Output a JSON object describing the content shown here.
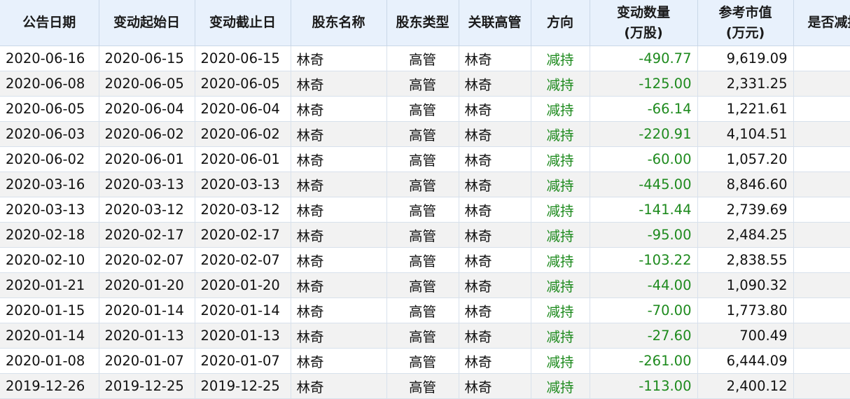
{
  "colors": {
    "header_bg": "#e8f1fc",
    "row_alt_bg": "#f2f2f2",
    "reduce_green": "#1d8a1d",
    "text": "#111111"
  },
  "columns": [
    {
      "key": "announce_date",
      "label": "公告日期",
      "label2": ""
    },
    {
      "key": "start_date",
      "label": "变动起始日",
      "label2": ""
    },
    {
      "key": "end_date",
      "label": "变动截止日",
      "label2": ""
    },
    {
      "key": "holder_name",
      "label": "股东名称",
      "label2": ""
    },
    {
      "key": "holder_type",
      "label": "股东类型",
      "label2": ""
    },
    {
      "key": "related_exec",
      "label": "关联高管",
      "label2": ""
    },
    {
      "key": "direction",
      "label": "方向",
      "label2": ""
    },
    {
      "key": "change_qty",
      "label": "变动数量",
      "label2": "(万股)"
    },
    {
      "key": "ref_value",
      "label": "参考市值",
      "label2": "(万元)"
    },
    {
      "key": "is_reduce",
      "label": "是否减持",
      "label2": ""
    }
  ],
  "rows": [
    [
      "2020-06-16",
      "2020-06-15",
      "2020-06-15",
      "林奇",
      "高管",
      "林奇",
      "减持",
      "-490.77",
      "9,619.09",
      "--"
    ],
    [
      "2020-06-08",
      "2020-06-05",
      "2020-06-05",
      "林奇",
      "高管",
      "林奇",
      "减持",
      "-125.00",
      "2,331.25",
      "--"
    ],
    [
      "2020-06-05",
      "2020-06-04",
      "2020-06-04",
      "林奇",
      "高管",
      "林奇",
      "减持",
      "-66.14",
      "1,221.61",
      "--"
    ],
    [
      "2020-06-03",
      "2020-06-02",
      "2020-06-02",
      "林奇",
      "高管",
      "林奇",
      "减持",
      "-220.91",
      "4,104.51",
      "--"
    ],
    [
      "2020-06-02",
      "2020-06-01",
      "2020-06-01",
      "林奇",
      "高管",
      "林奇",
      "减持",
      "-60.00",
      "1,057.20",
      "--"
    ],
    [
      "2020-03-16",
      "2020-03-13",
      "2020-03-13",
      "林奇",
      "高管",
      "林奇",
      "减持",
      "-445.00",
      "8,846.60",
      "--"
    ],
    [
      "2020-03-13",
      "2020-03-12",
      "2020-03-12",
      "林奇",
      "高管",
      "林奇",
      "减持",
      "-141.44",
      "2,739.69",
      "--"
    ],
    [
      "2020-02-18",
      "2020-02-17",
      "2020-02-17",
      "林奇",
      "高管",
      "林奇",
      "减持",
      "-95.00",
      "2,484.25",
      "--"
    ],
    [
      "2020-02-10",
      "2020-02-07",
      "2020-02-07",
      "林奇",
      "高管",
      "林奇",
      "减持",
      "-103.22",
      "2,838.55",
      "--"
    ],
    [
      "2020-01-21",
      "2020-01-20",
      "2020-01-20",
      "林奇",
      "高管",
      "林奇",
      "减持",
      "-44.00",
      "1,090.32",
      "--"
    ],
    [
      "2020-01-15",
      "2020-01-14",
      "2020-01-14",
      "林奇",
      "高管",
      "林奇",
      "减持",
      "-70.00",
      "1,773.80",
      "--"
    ],
    [
      "2020-01-14",
      "2020-01-13",
      "2020-01-13",
      "林奇",
      "高管",
      "林奇",
      "减持",
      "-27.60",
      "700.49",
      "--"
    ],
    [
      "2020-01-08",
      "2020-01-07",
      "2020-01-07",
      "林奇",
      "高管",
      "林奇",
      "减持",
      "-261.00",
      "6,444.09",
      "--"
    ],
    [
      "2019-12-26",
      "2019-12-25",
      "2019-12-25",
      "林奇",
      "高管",
      "林奇",
      "减持",
      "-113.00",
      "2,400.12",
      "--"
    ]
  ]
}
